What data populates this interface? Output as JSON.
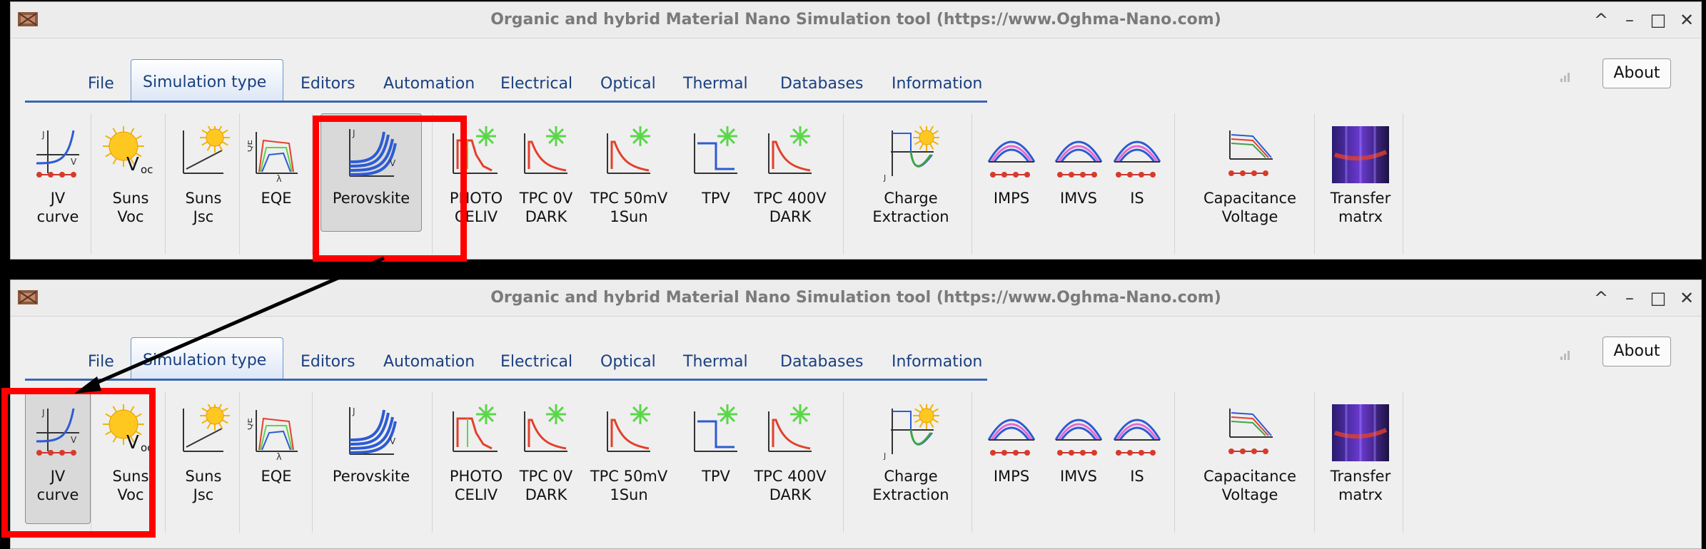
{
  "window_title": "Organic and hybrid Material Nano Simulation tool (https://www.Oghma-Nano.com)",
  "window_controls": [
    "^",
    "–",
    "□",
    "✕"
  ],
  "tabs": [
    "File",
    "Simulation type",
    "Editors",
    "Automation",
    "Electrical",
    "Optical",
    "Thermal",
    "Databases",
    "Information"
  ],
  "active_tab": "Simulation type",
  "about_label": "About",
  "tools": {
    "jv": [
      "JV",
      "curve"
    ],
    "suns_voc": [
      "Suns",
      "Voc"
    ],
    "suns_jsc": [
      "Suns",
      "Jsc"
    ],
    "eqe": [
      "EQE"
    ],
    "perovskite": [
      "Perovskite"
    ],
    "photo_celiv": [
      "PHOTO",
      "CELIV"
    ],
    "tpc_0v": [
      "TPC 0V",
      "DARK"
    ],
    "tpc_50mv": [
      "TPC 50mV",
      "1Sun"
    ],
    "tpv": [
      "TPV"
    ],
    "tpc_400v": [
      "TPC 400V",
      "DARK"
    ],
    "charge_extraction": [
      "Charge",
      "Extraction"
    ],
    "imps": [
      "IMPS"
    ],
    "imvs": [
      "IMVS"
    ],
    "is": [
      "IS"
    ],
    "capacitance_voltage": [
      "Capacitance",
      "Voltage"
    ],
    "transfer_matrix": [
      "Transfer",
      "matrx"
    ]
  },
  "pressed_top": "perovskite",
  "pressed_bottom": "jv",
  "icon_text": {
    "j": "J",
    "v": "V",
    "voc": "V",
    "voc_sub": "oc",
    "qe": "QE",
    "lambda": "λ"
  },
  "colors": {
    "highlight": "#ff0000",
    "accent": "#3b67b2",
    "curve_blue": "#2d5bd3",
    "curve_red": "#e2402c",
    "laser_green": "#5bd64a"
  }
}
